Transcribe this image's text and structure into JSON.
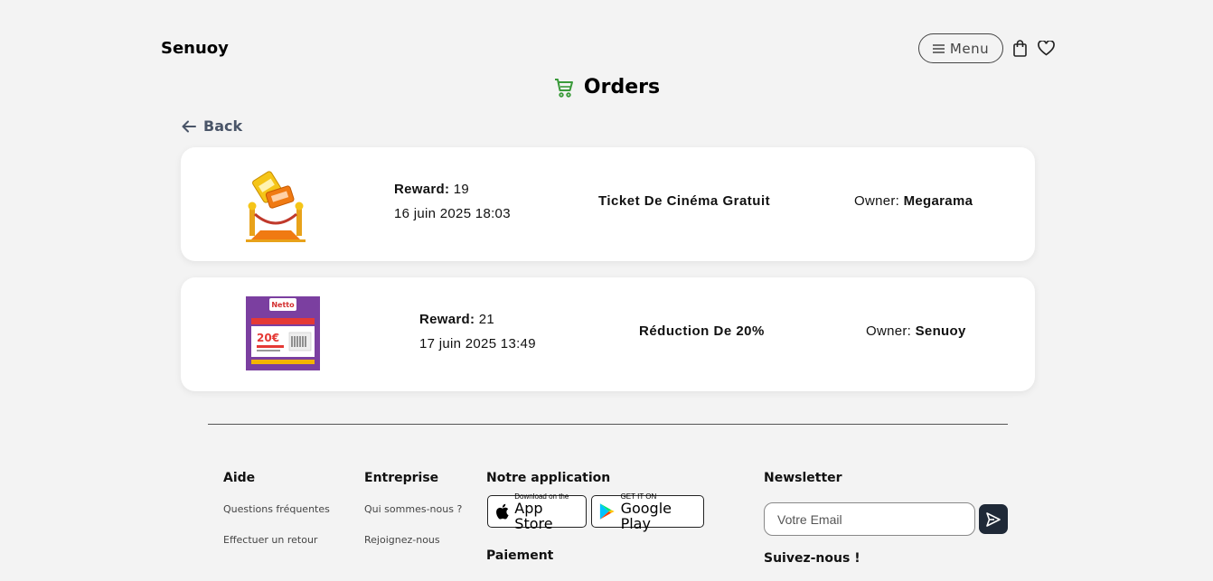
{
  "header": {
    "brand": "Senuoy",
    "menu_label": "Menu",
    "icons": [
      "bag-icon",
      "heart-icon"
    ]
  },
  "page": {
    "title": "Orders",
    "title_icon": "cart-icon",
    "back_label": "Back"
  },
  "orders": [
    {
      "image": "cinema-tickets-illustration",
      "reward_label": "Reward:",
      "reward": "19",
      "date": "16 juin 2025 18:03",
      "name": "Ticket De Cinéma Gratuit",
      "owner_label": "Owner:",
      "owner": "Megarama"
    },
    {
      "image": "netto-coupon-20-euro",
      "coupon_brand": "Netto",
      "coupon_amount": "20€",
      "reward_label": "Reward:",
      "reward": "21",
      "date": "17 juin 2025 13:49",
      "name": "Réduction De 20%",
      "owner_label": "Owner:",
      "owner": "Senuoy"
    }
  ],
  "footer": {
    "aide": {
      "title": "Aide",
      "links": [
        "Questions fréquentes",
        "Effectuer un retour"
      ]
    },
    "entreprise": {
      "title": "Entreprise",
      "links": [
        "Qui sommes-nous ?",
        "Rejoignez-nous"
      ]
    },
    "app": {
      "title": "Notre application",
      "app_store_small": "Download on the",
      "app_store_big": "App Store",
      "google_small": "GET IT ON",
      "google_big": "Google Play"
    },
    "paiement_title": "Paiement",
    "newsletter": {
      "title": "Newsletter",
      "placeholder": "Votre Email"
    },
    "social_title": "Suivez-nous !"
  },
  "colors": {
    "accent_green": "#3a9a3a",
    "background": "#f3f3f3",
    "card": "#ffffff",
    "send_button": "#1f2937"
  }
}
